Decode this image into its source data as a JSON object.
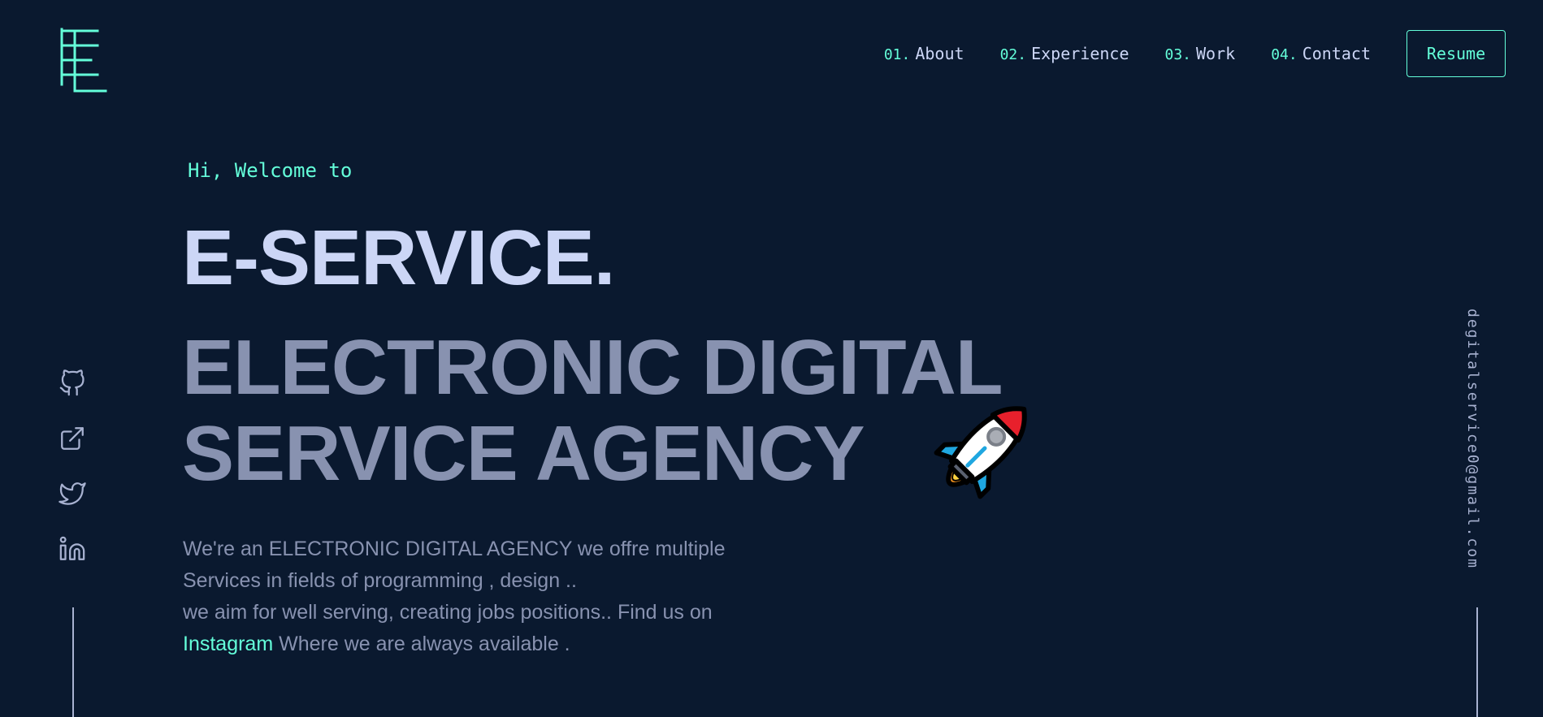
{
  "nav": {
    "items": [
      {
        "number": "01.",
        "label": "About"
      },
      {
        "number": "02.",
        "label": "Experience"
      },
      {
        "number": "03.",
        "label": "Work"
      },
      {
        "number": "04.",
        "label": "Contact"
      }
    ],
    "resume_label": "Resume"
  },
  "hero": {
    "greeting": "Hi, Welcome to",
    "title": "E-SERVICE.",
    "subtitle_line1": "ELECTRONIC DIGITAL",
    "subtitle_line2": "SERVICE AGENCY",
    "description_line1": "We're an ELECTRONIC DIGITAL AGENCY we offre multiple",
    "description_line2": "Services in fields of programming , design ..",
    "description_line3": "we aim for well serving, creating jobs positions.. Find us on",
    "description_link": "Instagram",
    "description_line4": " Where we are always available ."
  },
  "socials": [
    "github-icon",
    "external-link-icon",
    "twitter-icon",
    "linkedin-icon"
  ],
  "email": "degitalservice0@gmail.com",
  "colors": {
    "background": "#0a192f",
    "accent": "#64ffda",
    "heading": "#ccd6f6",
    "text": "#8892b0"
  }
}
